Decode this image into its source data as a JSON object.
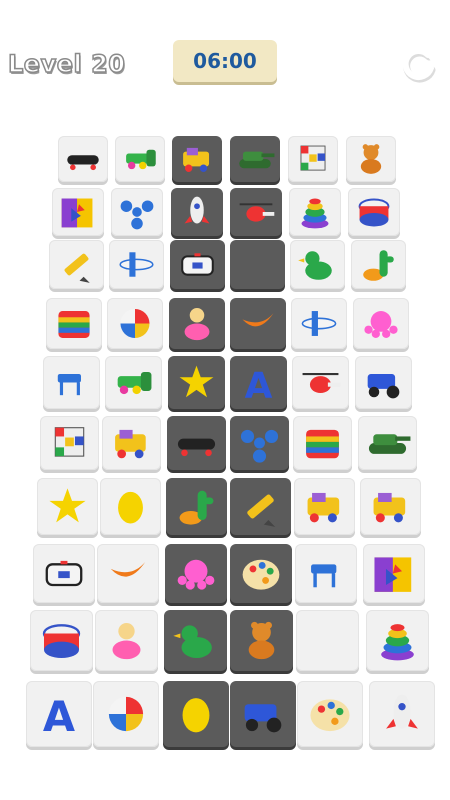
{
  "hud": {
    "level_label": "Level 20",
    "timer": "06:00",
    "restart_icon": "restart-icon"
  },
  "colors": {
    "tile_light": "#f1f1f1",
    "tile_dark": "#5b5b5b",
    "timer_bg": "#f2e8c4",
    "timer_text": "#1f5a9e"
  },
  "board": {
    "rows": [
      [
        "skateboard",
        "green-cannon",
        "toy-train-car",
        "tank",
        "rubiks-cube",
        "teddy-bear"
      ],
      [
        "alphabet-block",
        "fidget-spinner",
        "rocket",
        "helicopter",
        "ring-stacker",
        "toy-drum"
      ],
      [
        "pencil",
        "airplane",
        "police-car",
        "empty",
        "rubber-duck",
        "cactus-toy"
      ],
      [
        "pop-it",
        "beach-ball",
        "doll",
        "boomerang",
        "airplane",
        "octopus"
      ],
      [
        "toy-chair",
        "green-cannon",
        "star",
        "letter-a",
        "helicopter",
        "blue-tractor"
      ],
      [
        "rubiks-cube",
        "toy-train-car",
        "skateboard",
        "fidget-spinner",
        "pop-it",
        "tank"
      ],
      [
        "star",
        "lemon",
        "cactus-toy",
        "pencil",
        "toy-train-car",
        "toy-train-car"
      ],
      [
        "police-car",
        "boomerang",
        "octopus",
        "paint-palette",
        "toy-chair",
        "alphabet-block"
      ],
      [
        "toy-drum",
        "doll",
        "rubber-duck",
        "teddy-bear",
        "empty",
        "ring-stacker"
      ],
      [
        "letter-a",
        "beach-ball",
        "lemon",
        "blue-tractor",
        "paint-palette",
        "rocket"
      ]
    ],
    "dark_tiles": [
      [
        0,
        2
      ],
      [
        0,
        3
      ],
      [
        1,
        2
      ],
      [
        1,
        3
      ],
      [
        2,
        2
      ],
      [
        2,
        3
      ],
      [
        3,
        2
      ],
      [
        3,
        3
      ],
      [
        4,
        2
      ],
      [
        4,
        3
      ],
      [
        5,
        2
      ],
      [
        5,
        3
      ],
      [
        6,
        2
      ],
      [
        6,
        3
      ],
      [
        7,
        2
      ],
      [
        7,
        3
      ],
      [
        8,
        2
      ],
      [
        8,
        3
      ],
      [
        9,
        2
      ],
      [
        9,
        3
      ]
    ]
  }
}
